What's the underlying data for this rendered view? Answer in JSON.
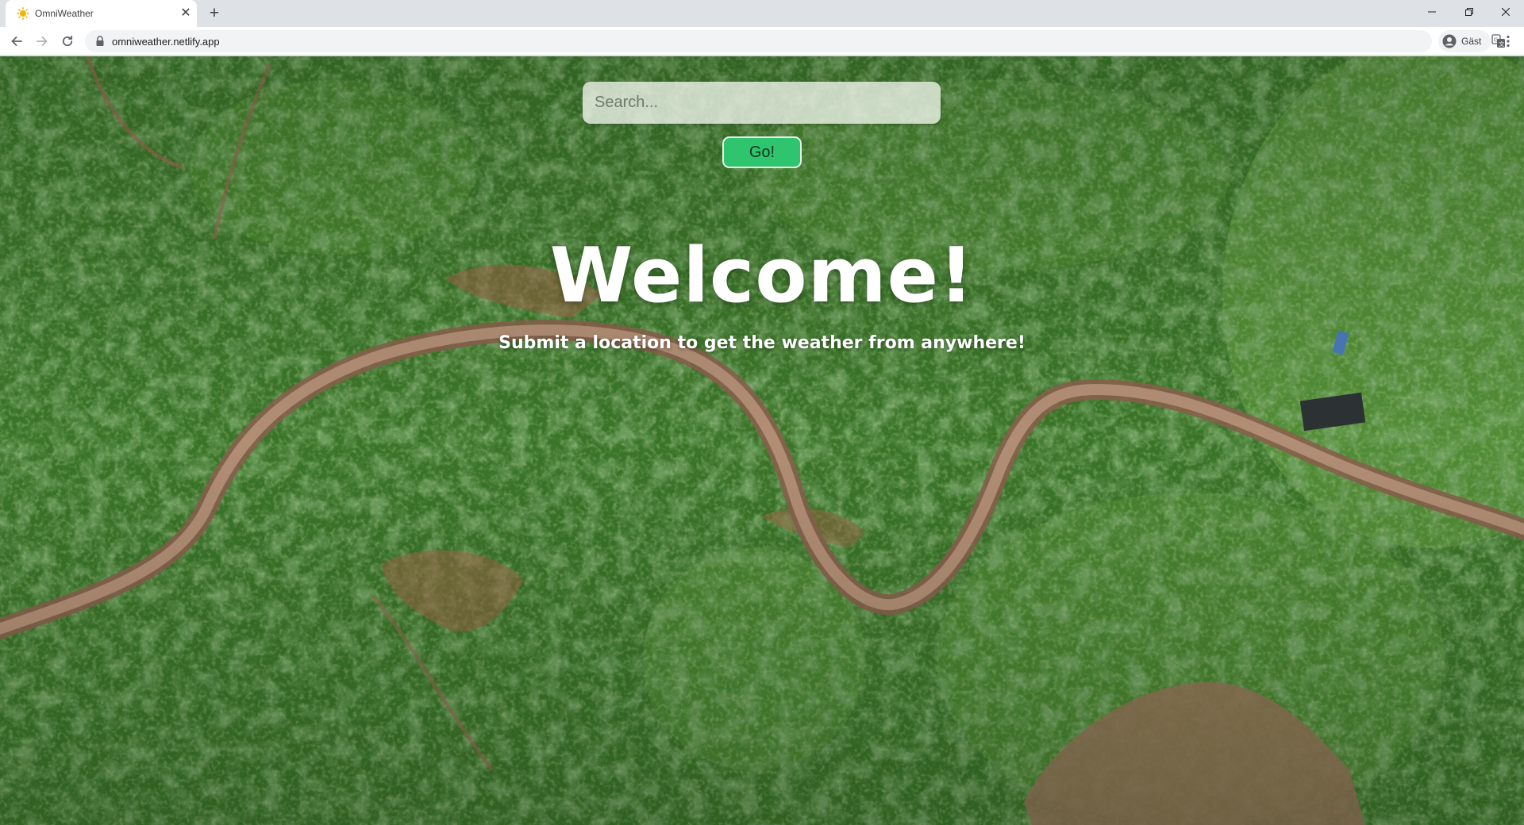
{
  "browser": {
    "tab": {
      "title": "OmniWeather",
      "favicon": "sun-icon"
    },
    "address_bar": {
      "url": "omniweather.netlify.app"
    },
    "profile": {
      "label": "Gäst"
    }
  },
  "page": {
    "search": {
      "placeholder": "Search..."
    },
    "go_button": {
      "label": "Go!"
    },
    "hero": {
      "title": "Welcome!",
      "subtitle": "Submit a location to get the weather from anywhere!"
    }
  },
  "colors": {
    "go_button": "#2ec56e",
    "road": "#b9896a",
    "forest": "#3d7a2b"
  }
}
